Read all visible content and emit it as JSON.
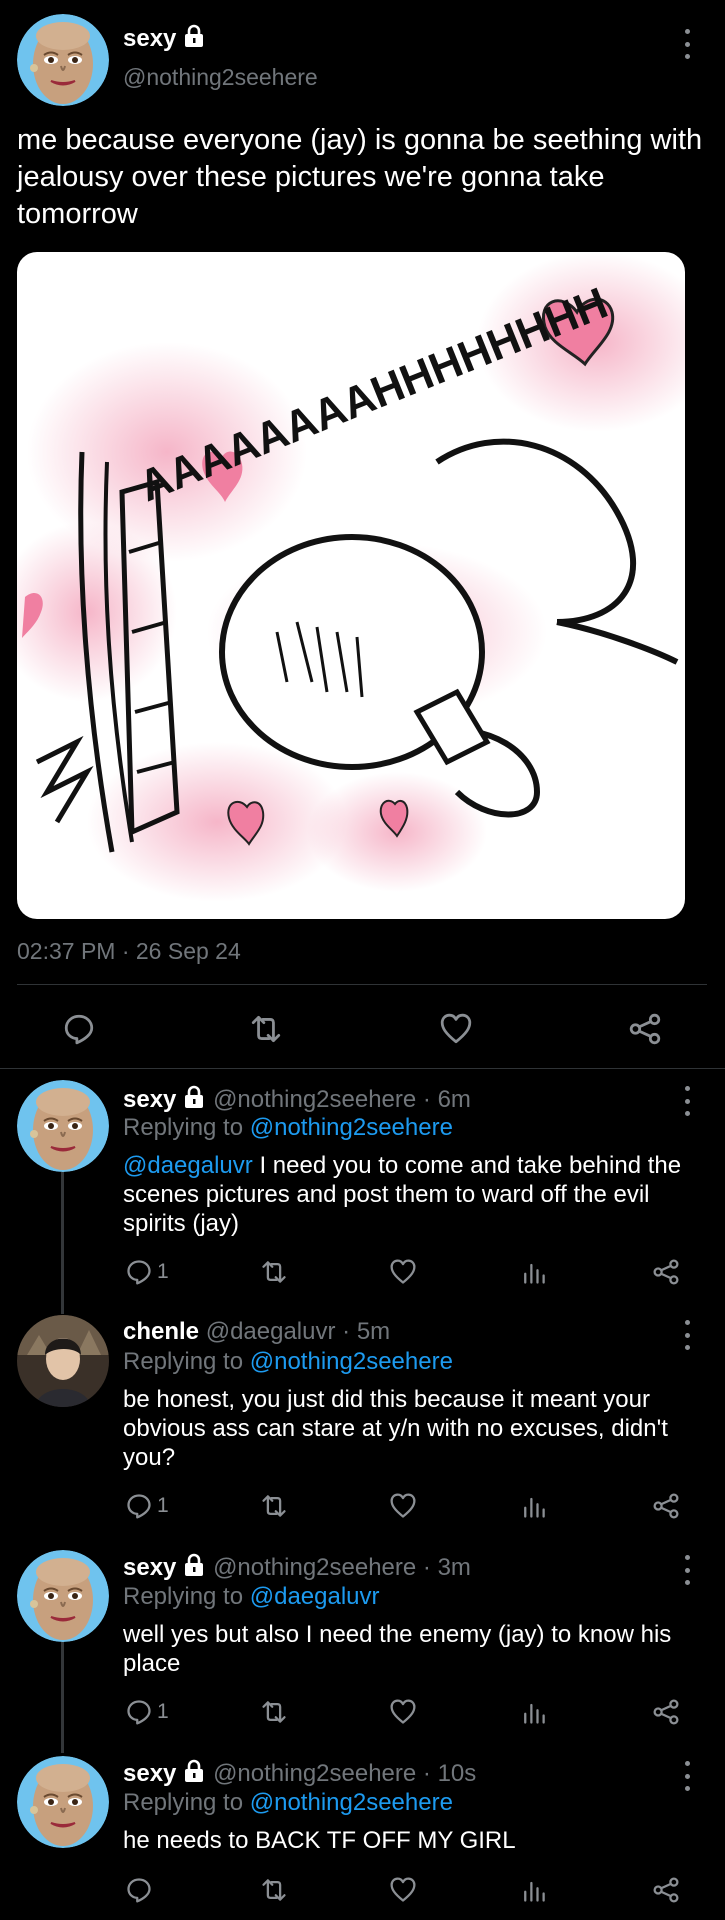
{
  "main_tweet": {
    "display_name": "sexy",
    "handle": "@nothing2seehere",
    "text": "me because everyone (jay) is gonna be seething with jealousy over these pictures we're gonna take tomorrow",
    "image_text": "AAAAAAAAHHHHHHHH",
    "timestamp": "02:37 PM · 26 Sep 24"
  },
  "replies": [
    {
      "display_name": "sexy",
      "handle": "@nothing2seehere",
      "time": "· 6m",
      "replying_label": "Replying to",
      "replying_to": "@nothing2seehere",
      "mention": "@daegaluvr",
      "text": " I need you to come and take behind the scenes pictures and post them to ward off the evil spirits (jay)",
      "reply_count": "1"
    },
    {
      "display_name": "chenle",
      "handle": "@daegaluvr",
      "time": "· 5m",
      "replying_label": "Replying to",
      "replying_to": "@nothing2seehere",
      "text": "be honest, you just did this because it meant your obvious ass can stare at y/n with no excuses, didn't you?",
      "reply_count": "1"
    },
    {
      "display_name": "sexy",
      "handle": "@nothing2seehere",
      "time": "· 3m",
      "replying_label": "Replying to",
      "replying_to": "@daegaluvr",
      "text": "well yes but also I need the enemy (jay) to know his place",
      "reply_count": "1"
    },
    {
      "display_name": "sexy",
      "handle": "@nothing2seehere",
      "time": "· 10s",
      "replying_label": "Replying to",
      "replying_to": "@nothing2seehere",
      "text": "he needs to BACK TF OFF MY GIRL"
    }
  ],
  "colors": {
    "background": "#000000",
    "text": "#e7e9ea",
    "muted": "#71767b",
    "link": "#1d9bf0"
  },
  "icons": [
    "reply-icon",
    "retweet-icon",
    "like-icon",
    "views-icon",
    "share-icon",
    "lock-icon",
    "more-icon"
  ]
}
